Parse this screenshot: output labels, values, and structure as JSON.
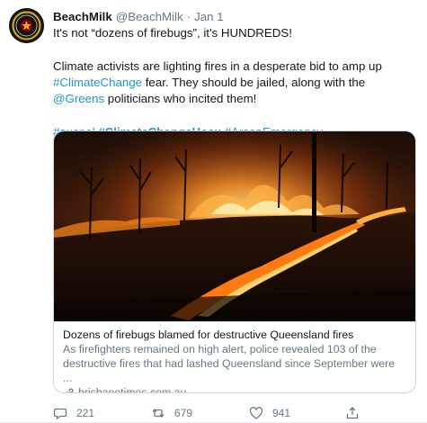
{
  "tweet": {
    "display_name": "BeachMilk",
    "handle": "@BeachMilk",
    "separator": "·",
    "date": "Jan 1",
    "line1": "It's not “dozens of firebugs”, it's HUNDREDS!",
    "para2": {
      "a": "Climate activists are lighting fires in a desperate bid to amp up ",
      "tag_climatechange": "#ClimateChange",
      "b": " fear.  They should be jailed, along with the ",
      "mention_greens": "@Greens",
      "c": " politicians who incited them!"
    },
    "hashtags": {
      "auspol": "#auspol",
      "climatechangehoax": "#ClimateChangeHoax",
      "arsonemergency": "#ArsonEmergency"
    }
  },
  "card": {
    "image_description_icon": "bushfire-photo",
    "title": "Dozens of firebugs blamed for destructive Queensland fires",
    "description_line1": "As firefighters remained on high alert, police revealed 103 of the",
    "description_line2": "destructive fires that had lashed Queensland since September were ...",
    "domain": "brisbanetimes.com.au"
  },
  "actions": {
    "reply_count": "221",
    "retweet_count": "679",
    "like_count": "941"
  },
  "colors": {
    "link": "#1b95e0",
    "secondary_text": "#657786",
    "border": "#ccd6dd"
  }
}
